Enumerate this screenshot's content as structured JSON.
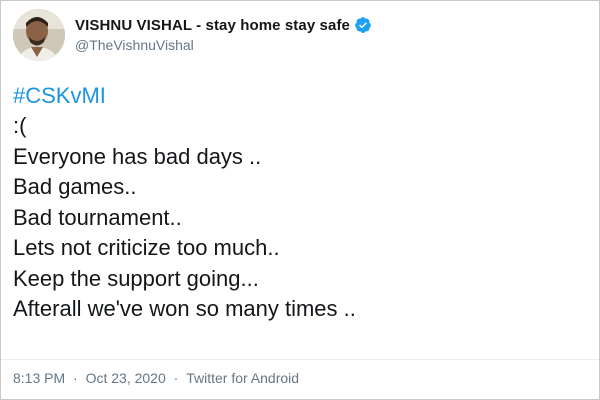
{
  "tweet": {
    "author": {
      "display_name": "VISHNU VISHAL - stay home stay safe",
      "handle": "@TheVishnuVishal",
      "verified": true
    },
    "hashtag": "#CSKvMI",
    "lines": [
      ":(",
      "Everyone has bad days ..",
      "Bad games..",
      "Bad tournament..",
      "Lets not criticize too much..",
      "Keep the support going...",
      "Afterall we've won so many times .."
    ],
    "meta": {
      "time": "8:13 PM",
      "date": "Oct 23, 2020",
      "source": "Twitter for Android",
      "separator": "·"
    }
  },
  "colors": {
    "link": "#1b95e0",
    "verified_badge": "#1da1f2",
    "text": "#14171a",
    "muted": "#657786"
  },
  "icons": {
    "verified": "verified-badge-icon",
    "avatar": "profile-avatar"
  }
}
